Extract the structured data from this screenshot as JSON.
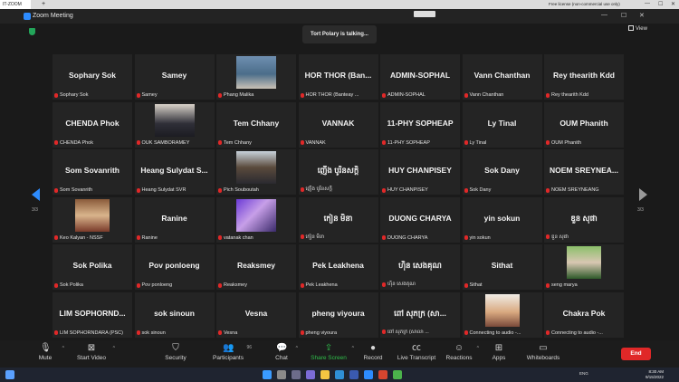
{
  "browser": {
    "tab_title": "IT-ZOOM",
    "new_tab": "+",
    "license": "Free license (non-commercial use only)",
    "minimize": "—",
    "maximize": "☐",
    "close": "✕"
  },
  "window": {
    "title": "Zoom Meeting",
    "minimize": "—",
    "maximize": "☐",
    "close": "✕"
  },
  "talking_banner": "Tort Polary is talking...",
  "view_button": "View",
  "page_left": "3/3",
  "page_right": "3/3",
  "tiles": [
    {
      "name": "Sophary Sok",
      "label": "Sophary Sok",
      "video": ""
    },
    {
      "name": "Samey",
      "label": "Samey",
      "video": ""
    },
    {
      "name": "",
      "label": "Phang Malika",
      "video": "video"
    },
    {
      "name": "HOR THOR (Ban...",
      "label": "HOR THOR (Banteay ...",
      "video": ""
    },
    {
      "name": "ADMIN-SOPHAL",
      "label": "ADMIN-SOPHAL",
      "video": ""
    },
    {
      "name": "Vann Chanthan",
      "label": "Vann Chanthan",
      "video": ""
    },
    {
      "name": "Rey thearith Kdd",
      "label": "Rey thearith Kdd",
      "video": ""
    },
    {
      "name": "CHENDA Phok",
      "label": "CHENDA Phok",
      "video": ""
    },
    {
      "name": "",
      "label": "OUK SAMBORAMEY",
      "video": "portrait"
    },
    {
      "name": "Tem Chhany",
      "label": "Tem Chhany",
      "video": ""
    },
    {
      "name": "VANNAK",
      "label": "VANNAK",
      "video": ""
    },
    {
      "name": "11-PHY SOPHEAP",
      "label": "11-PHY SOPHEAP",
      "video": ""
    },
    {
      "name": "Ly Tinal",
      "label": "Ly Tinal",
      "video": ""
    },
    {
      "name": "OUM Phanith",
      "label": "OUM Phanith",
      "video": ""
    },
    {
      "name": "Som Sovanrith",
      "label": "Som Sovanrith",
      "video": ""
    },
    {
      "name": "Heang Sulydat S...",
      "label": "Heang Sulydat SVR",
      "video": ""
    },
    {
      "name": "",
      "label": "Pich Souboutah",
      "video": "woman"
    },
    {
      "name": "ញើង បូរិនសក្តិ",
      "label": "ញើង បូរិនសក្តិ",
      "video": ""
    },
    {
      "name": "HUY CHANPISEY",
      "label": "HUY CHANPISEY",
      "video": ""
    },
    {
      "name": "Sok Dany",
      "label": "Sok Dany",
      "video": ""
    },
    {
      "name": "NOEM SREYNEA...",
      "label": "NOEM SREYNEANG",
      "video": ""
    },
    {
      "name": "",
      "label": "Keo Kalyan - NSSF",
      "video": "avatar"
    },
    {
      "name": "Ranine",
      "label": "Ranine",
      "video": ""
    },
    {
      "name": "",
      "label": "vatanak chan",
      "video": "blur"
    },
    {
      "name": "កៀន មិនា",
      "label": "កៀន មិនា",
      "video": ""
    },
    {
      "name": "DUONG CHARYA",
      "label": "DUONG CHARYA",
      "video": ""
    },
    {
      "name": "yin sokun",
      "label": "yin sokun",
      "video": ""
    },
    {
      "name": "ឌួន សុផា",
      "label": "ឌួន សុផា",
      "video": ""
    },
    {
      "name": "Sok Polika",
      "label": "Sok Polika",
      "video": ""
    },
    {
      "name": "Pov ponloeng",
      "label": "Pov ponloeng",
      "video": ""
    },
    {
      "name": "Reaksmey",
      "label": "Reaksmey",
      "video": ""
    },
    {
      "name": "Pek Leakhena",
      "label": "Pek Leakhena",
      "video": ""
    },
    {
      "name": "ហ៊ិន សេងគុណ",
      "label": "ហ៊ិន សេងគុណ",
      "video": ""
    },
    {
      "name": "Sithat",
      "label": "Sithat",
      "video": ""
    },
    {
      "name": "",
      "label": "seng marya",
      "video": "green"
    },
    {
      "name": "LIM SOPHORND...",
      "label": "LIM SOPHORNDARA (PSC)",
      "video": ""
    },
    {
      "name": "sok sinoun",
      "label": "sok sinoun",
      "video": ""
    },
    {
      "name": "Vesna",
      "label": "Vesna",
      "video": ""
    },
    {
      "name": "pheng viyoura",
      "label": "pheng viyoura",
      "video": ""
    },
    {
      "name": "ពៅ សុភក្រ (សា...",
      "label": "ពៅ សុភក្រ (សាលា ...",
      "video": ""
    },
    {
      "name": "",
      "label": "Connecting to audio -...",
      "video": "face"
    },
    {
      "name": "Chakra Pok",
      "label": "Connecting to audio -...",
      "video": ""
    }
  ],
  "toolbar": {
    "mute": "Mute",
    "start_video": "Start Video",
    "security": "Security",
    "participants": "Participants",
    "participants_count": "96",
    "chat": "Chat",
    "share_screen": "Share Screen",
    "record": "Record",
    "live_transcript": "Live Transcript",
    "reactions": "Reactions",
    "apps": "Apps",
    "whiteboards": "Whiteboards",
    "end": "End"
  },
  "taskbar": {
    "lang": "ENG",
    "time": "8:30 AM",
    "date": "9/15/2022"
  },
  "colors": {
    "accent_blue": "#2d8cff",
    "end_red": "#e02828",
    "share_green": "#2fbf4a",
    "muted_red": "#e02828"
  }
}
